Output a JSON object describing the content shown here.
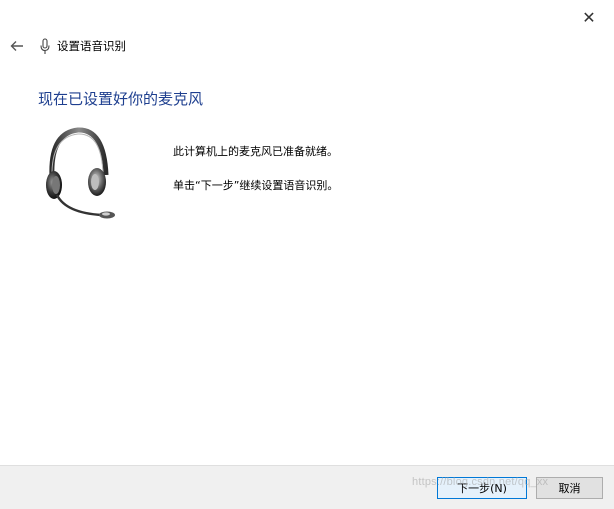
{
  "window": {
    "title": "设置语音识别",
    "close_glyph": "✕"
  },
  "main": {
    "heading": "现在已设置好你的麦克风",
    "line1": "此计算机上的麦克风已准备就绪。",
    "line2": "单击“下一步”继续设置语音识别。"
  },
  "footer": {
    "next_label": "下一步(N)",
    "cancel_label": "取消",
    "watermark": "https://blog.csdn.net/qq_xx"
  },
  "icons": {
    "back": "back-arrow-icon",
    "mic": "microphone-icon",
    "headset": "headset-icon"
  },
  "colors": {
    "heading": "#1e3f8f",
    "next_border": "#0078d7",
    "next_bg": "#e5f1fb",
    "footer_bg": "#f0f0f0"
  }
}
